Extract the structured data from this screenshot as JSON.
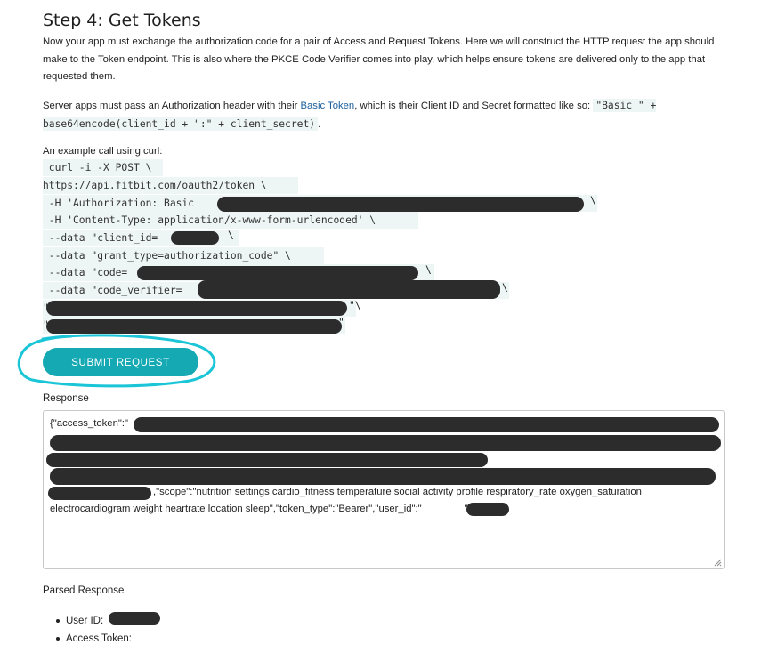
{
  "step_title": "Step 4: Get Tokens",
  "intro": "Now your app must exchange the authorization code for a pair of Access and Request Tokens. Here we will construct the HTTP request the app should make to the Token endpoint. This is also where the PKCE Code Verifier comes into play, which helps ensure tokens are delivered only to the app that requested them.",
  "server_apps": {
    "prefix": "Server apps must pass an Authorization header with their ",
    "link": "Basic Token",
    "middle": ", which is their Client ID and Secret formatted like so: ",
    "code": "\"Basic \" + base64encode(client_id + \":\" + client_secret)",
    "suffix": "."
  },
  "curl_intro": "An example call using curl:",
  "curl_lines": [
    " curl -i -X POST \\",
    "https://api.fitbit.com/oauth2/token \\",
    " -H 'Authorization: Basic ",
    " -H 'Content-Type: application/x-www-form-urlencoded' \\",
    " --data \"client_id=",
    " --data \"grant_type=authorization_code\" \\",
    " --data \"code=",
    " --data \"code_verifier=",
    "\"",
    "\""
  ],
  "submit_label": "SUBMIT REQUEST",
  "response_label": "Response",
  "response_start": "{\"access_token\":\"",
  "response_scope": ",\"scope\":\"nutrition settings cardio_fitness temperature social activity profile respiratory_rate oxygen_saturation",
  "response_end": "electrocardiogram weight heartrate location sleep\",\"token_type\":\"Bearer\",\"user_id\":\"",
  "response_close": "\"}",
  "parsed_label": "Parsed Response",
  "parsed_items": [
    "User ID:",
    "Access Token:"
  ],
  "colors": {
    "accent": "#14a9b3",
    "highlight_circle": "#19c5d6",
    "link": "#1a5f9c",
    "code_bg": "#eef5f5"
  }
}
